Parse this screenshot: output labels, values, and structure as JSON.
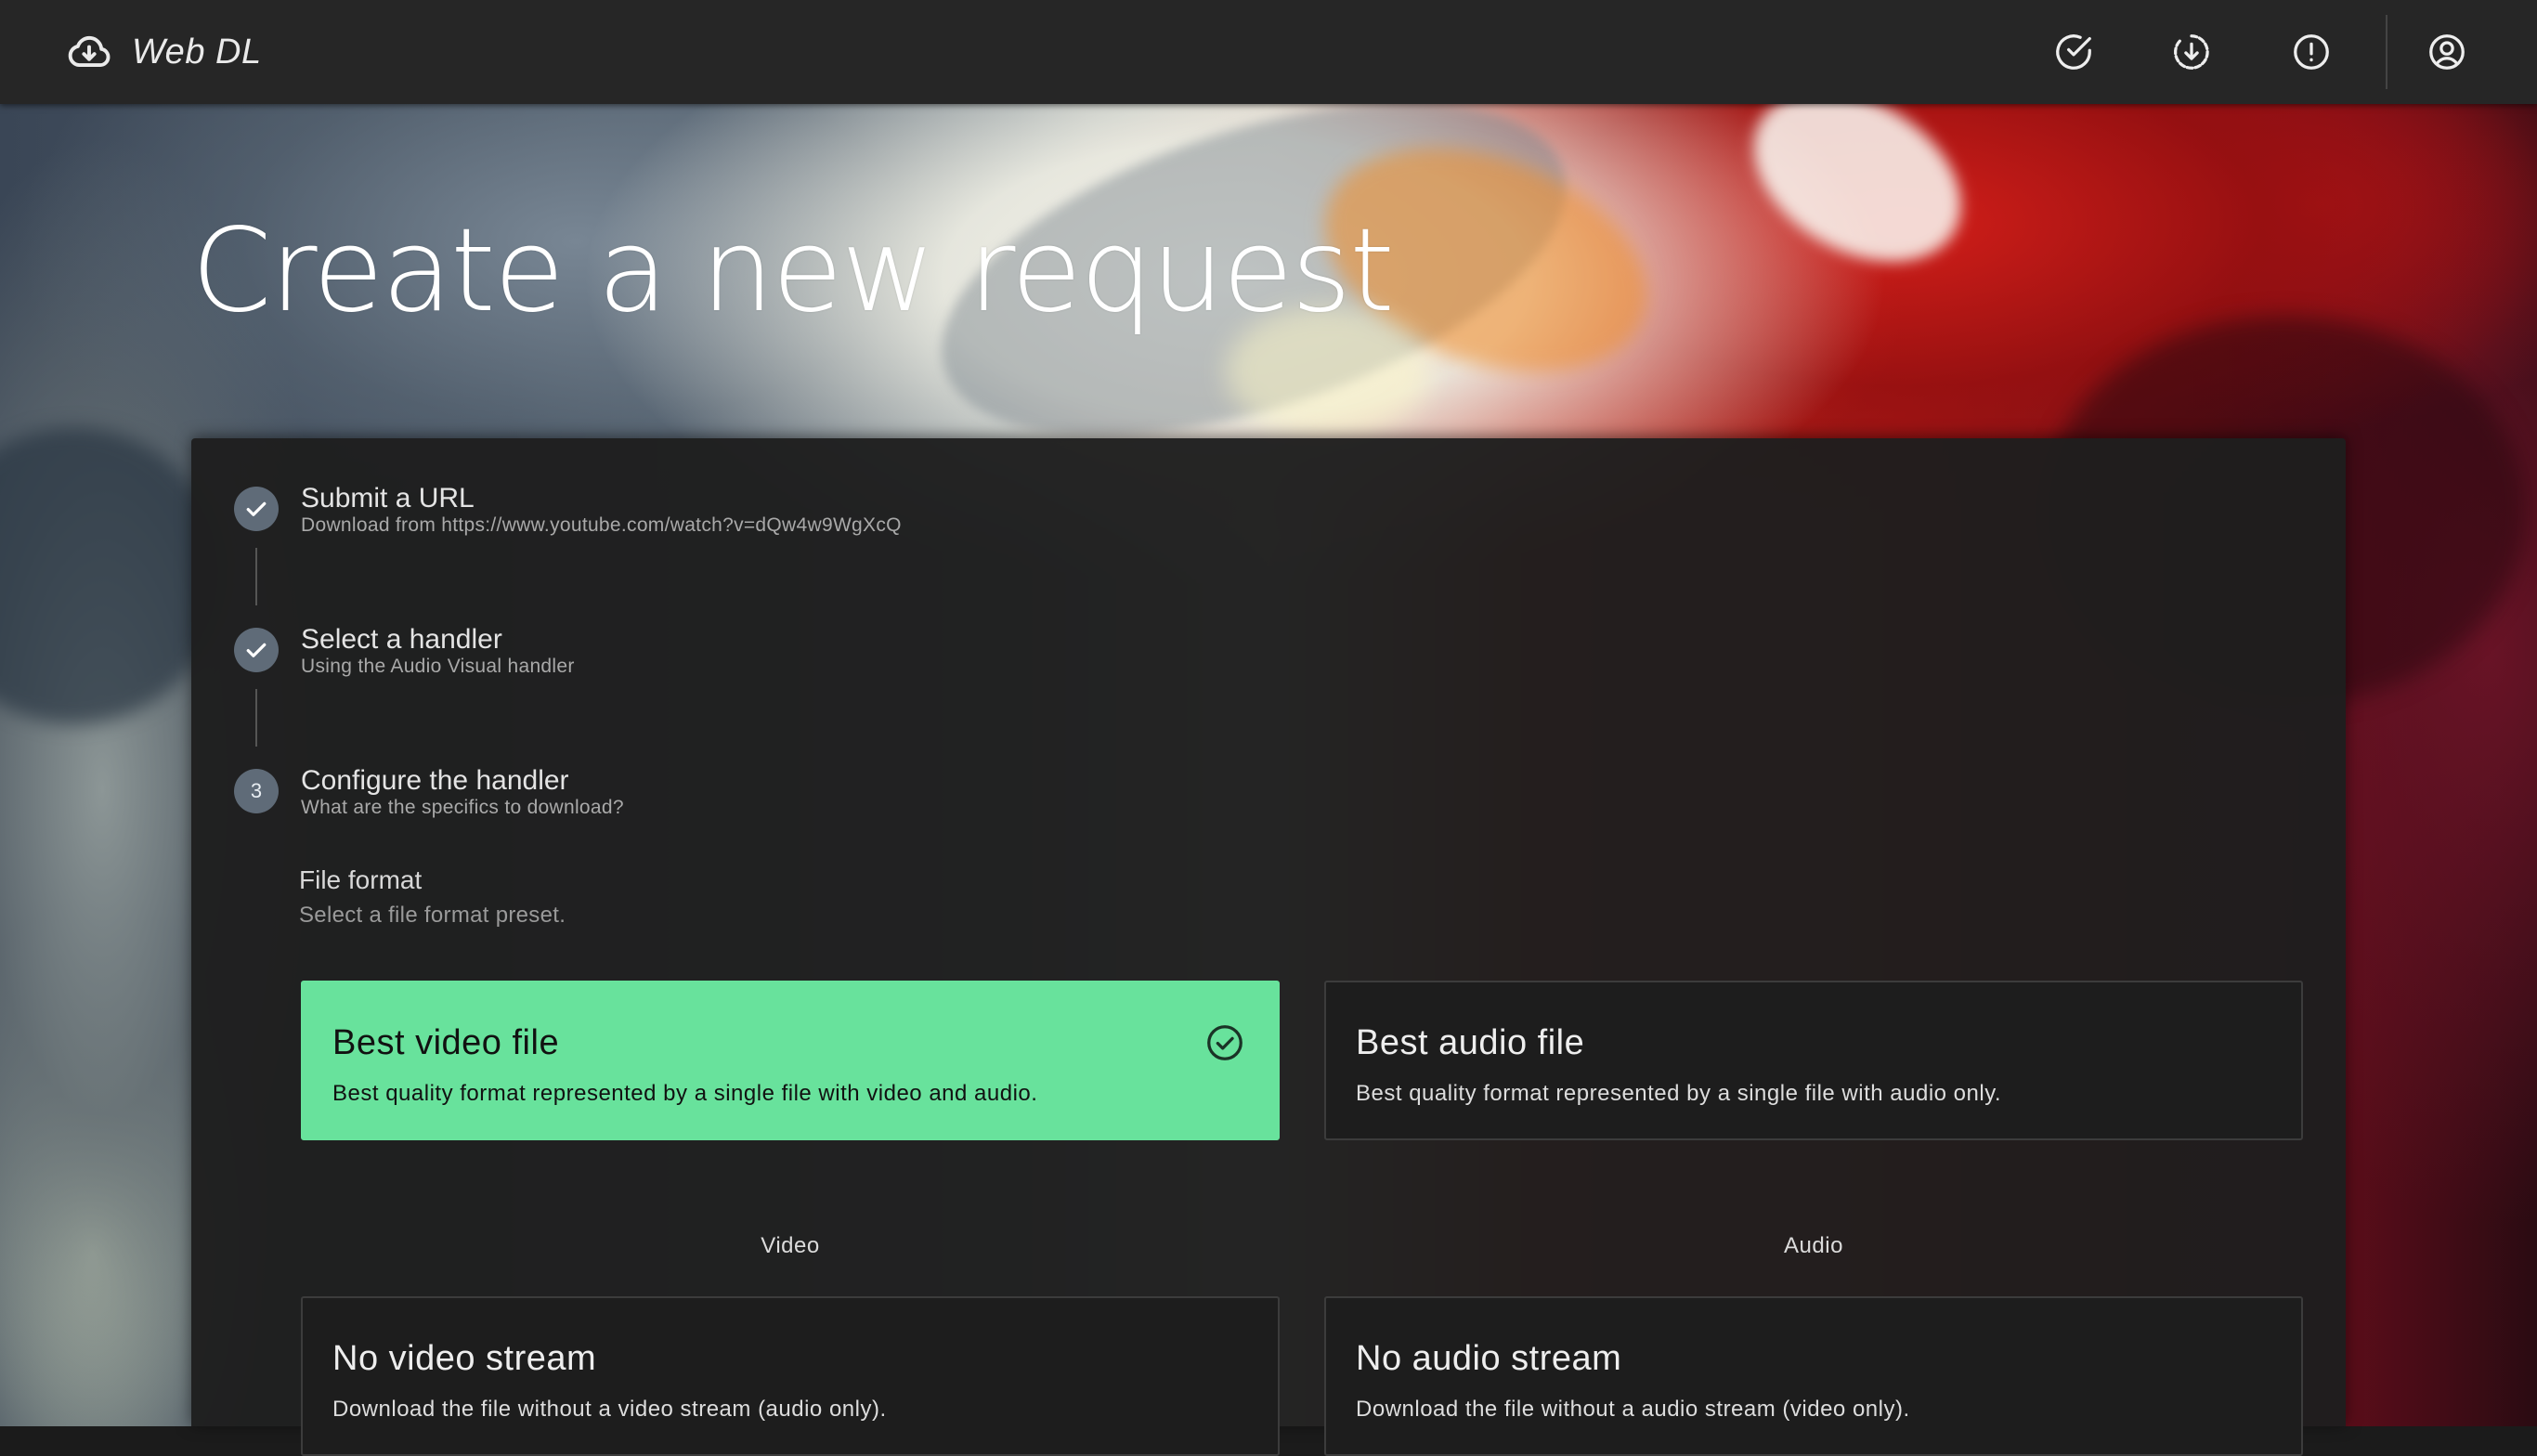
{
  "app": {
    "title": "Web DL"
  },
  "header": {
    "icons": [
      "check-circle-icon",
      "download-circle-icon",
      "alert-circle-icon",
      "account-circle-icon"
    ]
  },
  "page": {
    "title": "Create a new request"
  },
  "steps": [
    {
      "number": "1",
      "title": "Submit a URL",
      "subtitle": "Download from https://www.youtube.com/watch?v=dQw4w9WgXcQ",
      "status": "complete"
    },
    {
      "number": "2",
      "title": "Select a handler",
      "subtitle": "Using the Audio Visual handler",
      "status": "complete"
    },
    {
      "number": "3",
      "title": "Configure the handler",
      "subtitle": "What are the specifics to download?",
      "status": "active"
    }
  ],
  "file_format": {
    "title": "File format",
    "subtitle": "Select a file format preset.",
    "options": [
      {
        "title": "Best video file",
        "description": "Best quality format represented by a single file with video and audio.",
        "selected": true
      },
      {
        "title": "Best audio file",
        "description": "Best quality format represented by a single file with audio only.",
        "selected": false
      }
    ]
  },
  "streams": {
    "video": {
      "label": "Video",
      "option": {
        "title": "No video stream",
        "description": "Download the file without a video stream (audio only)."
      }
    },
    "audio": {
      "label": "Audio",
      "option": {
        "title": "No audio stream",
        "description": "Download the file without a audio stream (video only)."
      }
    }
  },
  "colors": {
    "header_bg": "#262626",
    "card_bg": "#1e1e1e",
    "selected_accent": "#68e29c",
    "step_icon": "#5f6b78"
  }
}
